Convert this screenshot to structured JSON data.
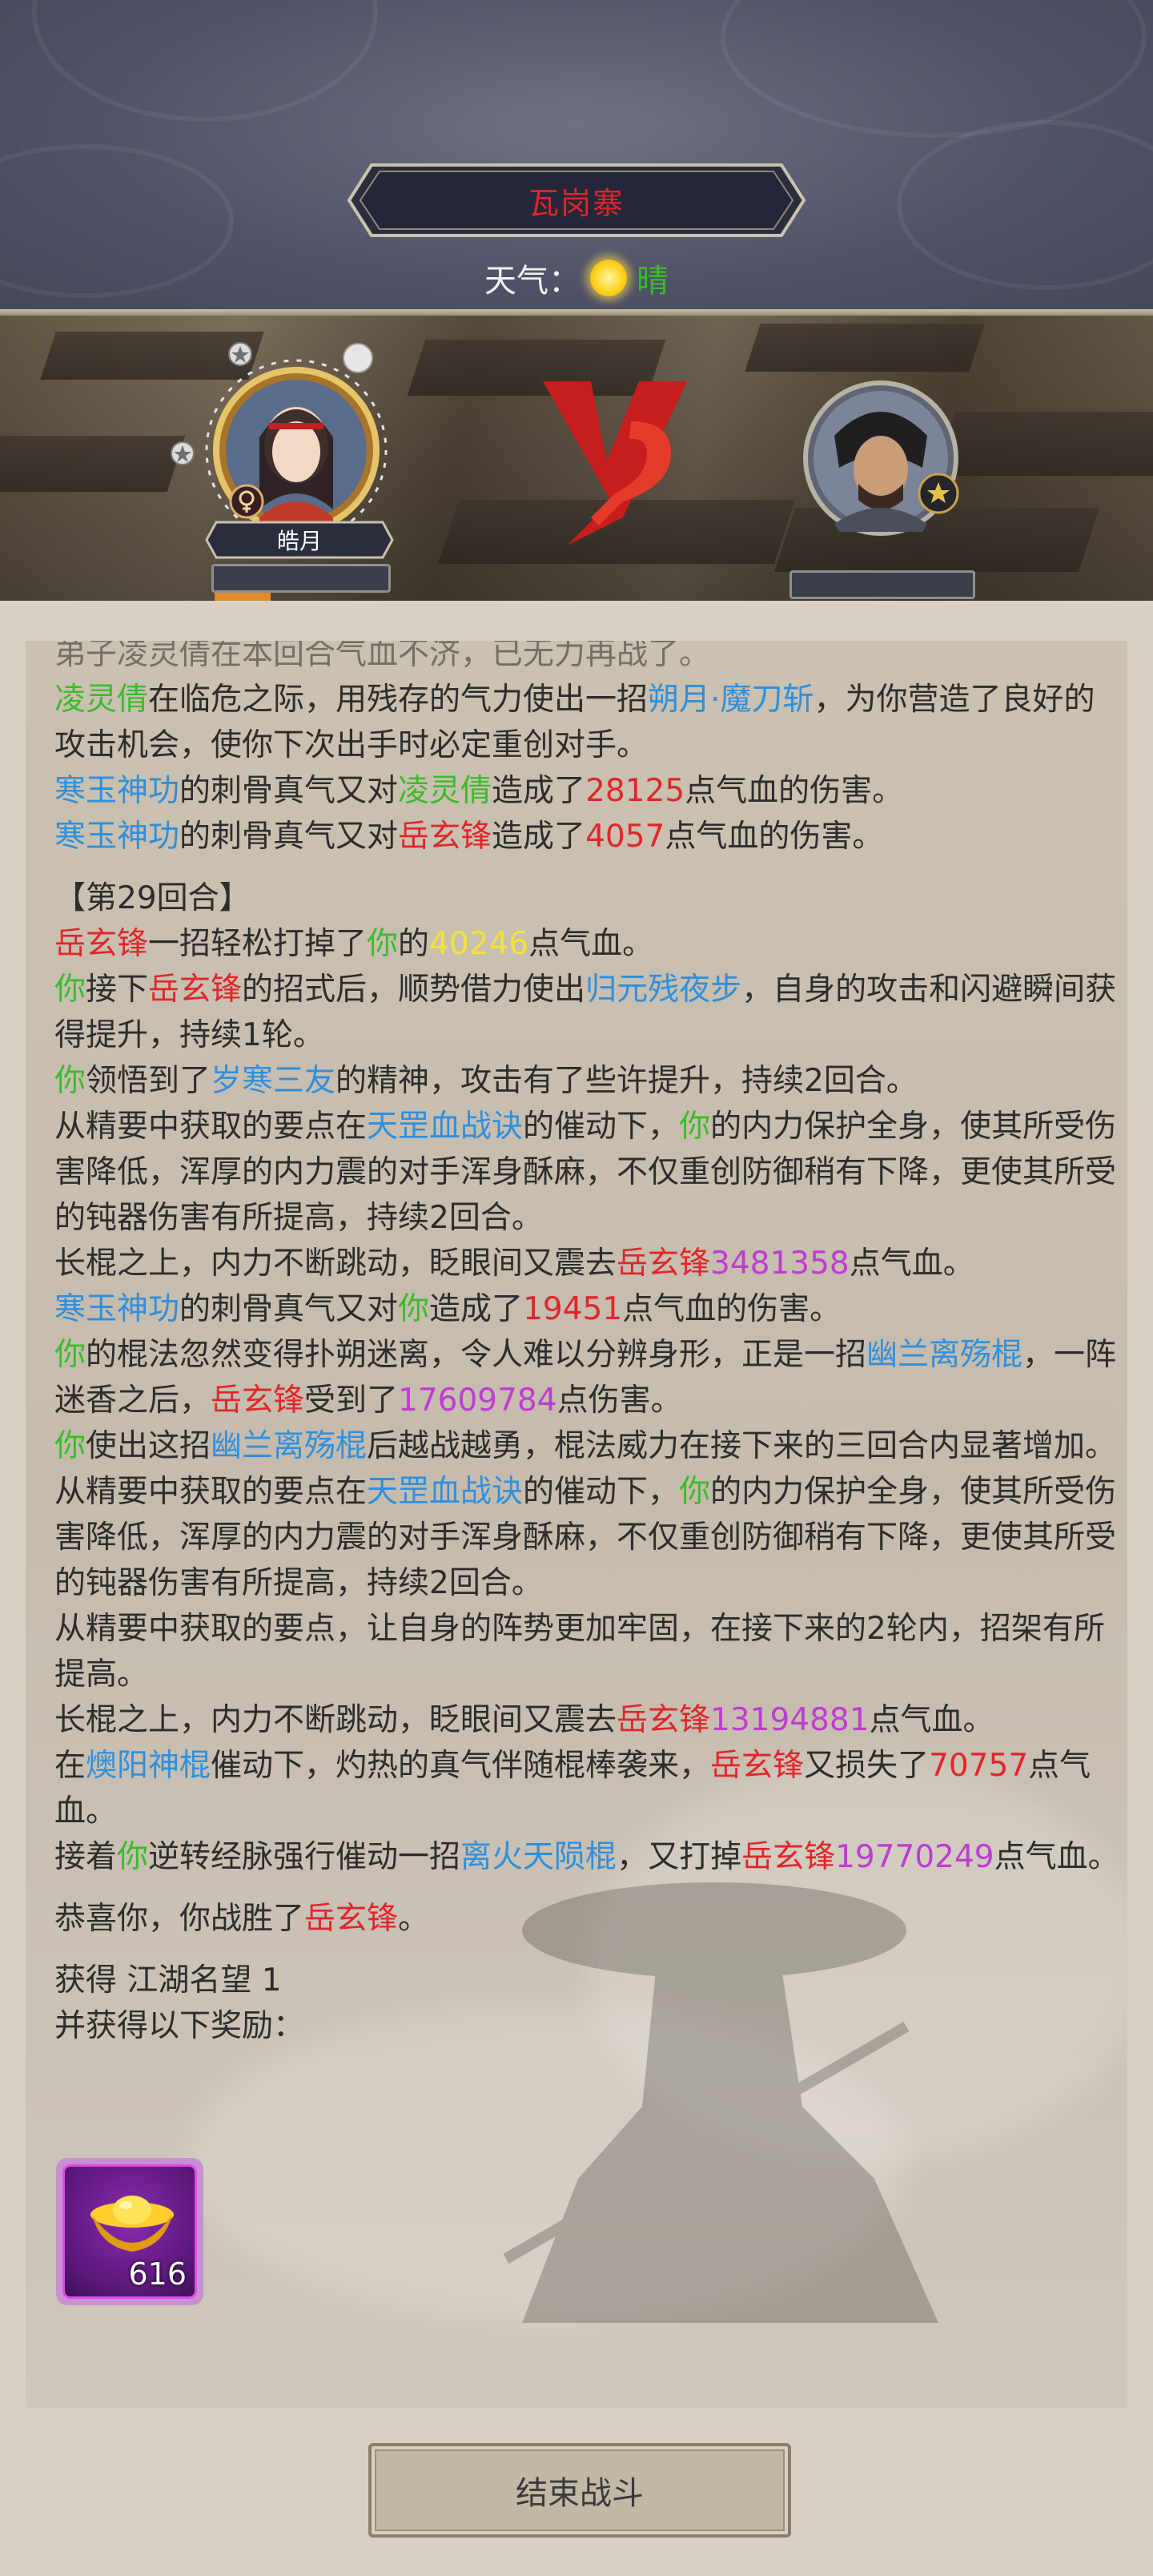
{
  "header": {
    "location": "瓦岗寨",
    "weather_label": "天气：",
    "weather_value": "晴",
    "weather_icon": "sun-icon"
  },
  "battle": {
    "player_name": "皓月",
    "player_gender_icon": "female-icon",
    "enemy_rank_icon": "rank-badge-icon",
    "vs_text": "VS"
  },
  "log": {
    "line0": "弟子凌灵倩在本回合气血不济，已无力再战了。",
    "l1": [
      "凌灵倩",
      "在临危之际，用残存的气力使出一招",
      "朔月·魔刀斩",
      "，为你营造了良好的攻击机会，使你下次出手时必定重创对手。"
    ],
    "l2": [
      "寒玉神功",
      "的刺骨真气又对",
      "凌灵倩",
      "造成了",
      "28125",
      "点气血的伤害。"
    ],
    "l3": [
      "寒玉神功",
      "的刺骨真气又对",
      "岳玄锋",
      "造成了",
      "4057",
      "点气血的伤害。"
    ],
    "round": "【第29回合】",
    "l4": [
      "岳玄锋",
      "一招轻松打掉了",
      "你",
      "的",
      "40246",
      "点气血。"
    ],
    "l5": [
      "你",
      "接下",
      "岳玄锋",
      "的招式后，顺势借力使出",
      "归元残夜步",
      "，自身的攻击和闪避瞬间获得提升，持续1轮。"
    ],
    "l6": [
      "你",
      "领悟到了",
      "岁寒三友",
      "的精神，攻击有了些许提升，持续2回合。"
    ],
    "l7": [
      "从精要中获取的要点在",
      "天罡血战诀",
      "的催动下，",
      "你",
      "的内力保护全身，使其所受伤害降低，浑厚的内力震的对手浑身酥麻，不仅重创防御稍有下降，更使其所受的钝器伤害有所提高，持续2回合。"
    ],
    "l8": [
      "长棍之上，内力不断跳动，眨眼间又震去",
      "岳玄锋",
      "3481358",
      "点气血。"
    ],
    "l9": [
      "寒玉神功",
      "的刺骨真气又对",
      "你",
      "造成了",
      "19451",
      "点气血的伤害。"
    ],
    "l10": [
      "你",
      "的棍法忽然变得扑朔迷离，令人难以分辨身形，正是一招",
      "幽兰离殇棍",
      "，一阵迷香之后，",
      "岳玄锋",
      "受到了",
      "17609784",
      "点伤害。"
    ],
    "l11": [
      "你",
      "使出这招",
      "幽兰离殇棍",
      "后越战越勇，棍法威力在接下来的三回合内显著增加。"
    ],
    "l12": [
      "从精要中获取的要点在",
      "天罡血战诀",
      "的催动下，",
      "你",
      "的内力保护全身，使其所受伤害降低，浑厚的内力震的对手浑身酥麻，不仅重创防御稍有下降，更使其所受的钝器伤害有所提高，持续2回合。"
    ],
    "l13": "从精要中获取的要点，让自身的阵势更加牢固，在接下来的2轮内，招架有所提高。",
    "l14": [
      "长棍之上，内力不断跳动，眨眼间又震去",
      "岳玄锋",
      "13194881",
      "点气血。"
    ],
    "l15": [
      "在",
      "燠阳神棍",
      "催动下，灼热的真气伴随棍棒袭来，",
      "岳玄锋",
      "又损失了",
      "70757",
      "点气血。"
    ],
    "l16": [
      "接着",
      "你",
      "逆转经脉强行催动一招",
      "离火天陨棍",
      "，又打掉",
      "岳玄锋",
      "19770249",
      "点气血。"
    ],
    "l17": [
      "恭喜你，你战胜了",
      "岳玄锋",
      "。"
    ],
    "reward_line1": "获得 江湖名望 1",
    "reward_line2": "并获得以下奖励："
  },
  "reward": {
    "item_icon": "gold-ingot-icon",
    "count": "616"
  },
  "end_button_label": "结束战斗"
}
